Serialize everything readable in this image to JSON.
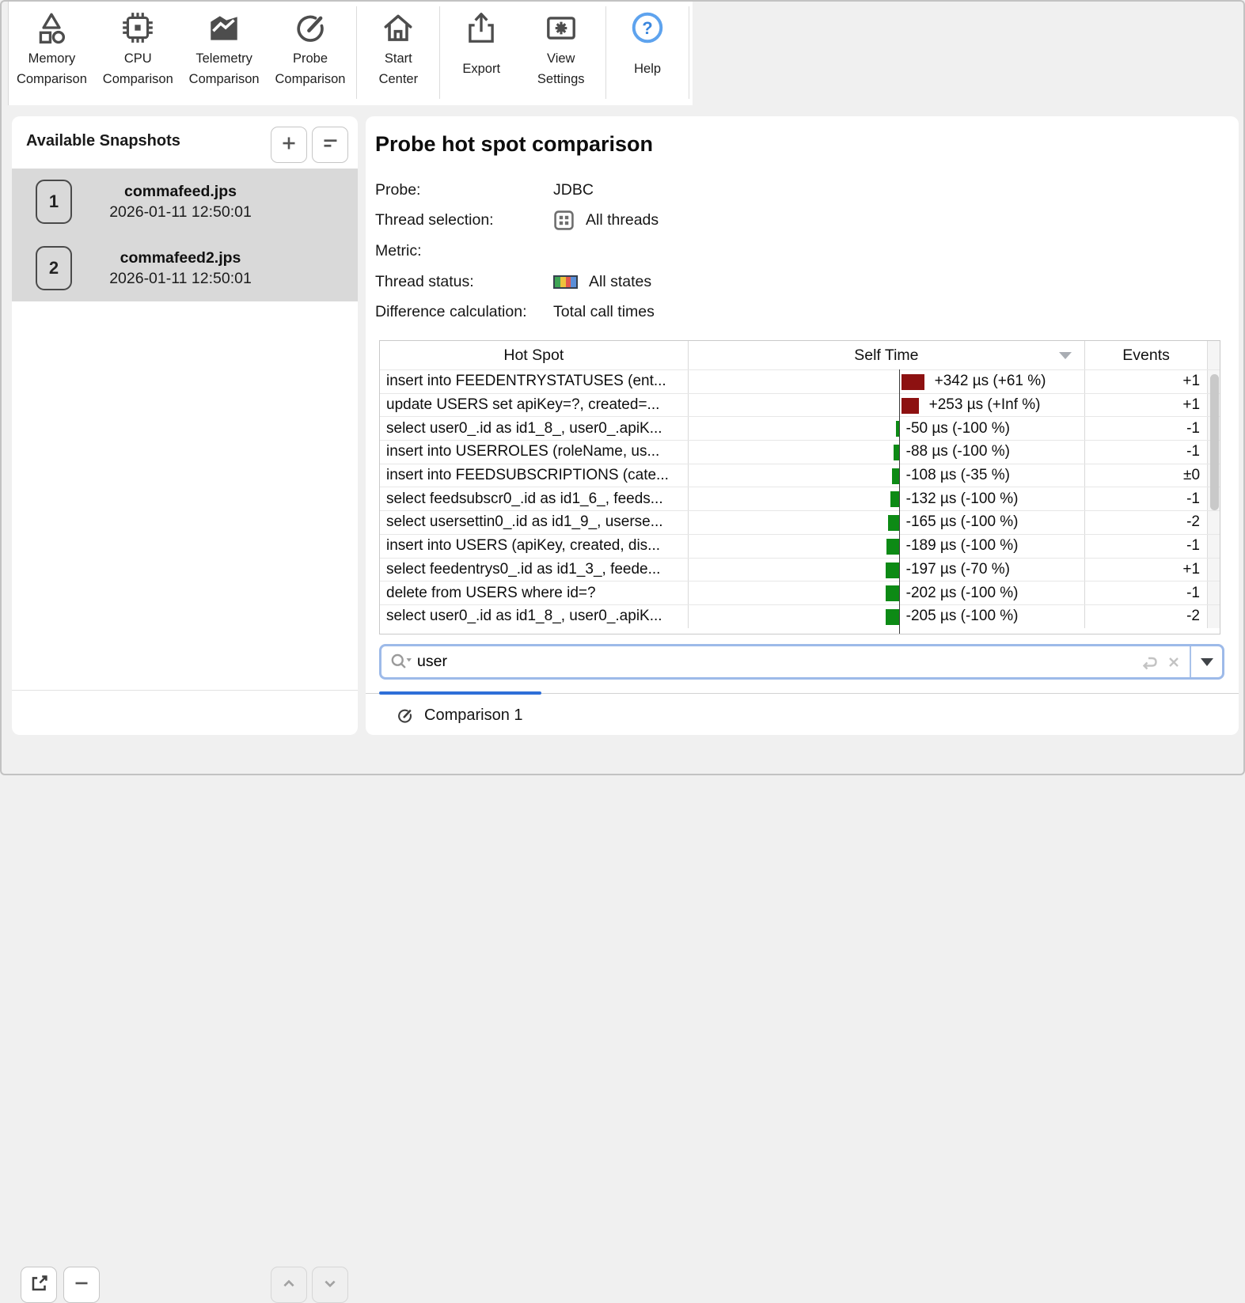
{
  "toolbar": {
    "groups": [
      {
        "items": [
          {
            "id": "memory-comparison",
            "label": "Memory Comparison"
          },
          {
            "id": "cpu-comparison",
            "label": "CPU Comparison"
          },
          {
            "id": "telemetry-comparison",
            "label": "Telemetry Comparison"
          },
          {
            "id": "probe-comparison",
            "label": "Probe Comparison"
          }
        ]
      },
      {
        "items": [
          {
            "id": "start-center",
            "label": "Start Center"
          }
        ]
      },
      {
        "items": [
          {
            "id": "export",
            "label": "Export"
          },
          {
            "id": "view-settings",
            "label": "View Settings"
          }
        ]
      },
      {
        "items": [
          {
            "id": "help",
            "label": "Help"
          }
        ]
      }
    ]
  },
  "snapshots": {
    "title": "Available Snapshots",
    "items": [
      {
        "index": "1",
        "name": "commafeed.jps",
        "date": "2026-01-11 12:50:01",
        "selected": true
      },
      {
        "index": "2",
        "name": "commafeed2.jps",
        "date": "2026-01-11 12:50:01",
        "selected": true
      }
    ]
  },
  "main": {
    "title": "Probe hot spot comparison",
    "details": [
      {
        "label": "Probe:",
        "value": "JDBC",
        "icon": null
      },
      {
        "label": "Thread selection:",
        "value": "All threads",
        "icon": "thread-selection"
      },
      {
        "label": "Metric:",
        "value": "",
        "icon": null
      },
      {
        "label": "Thread status:",
        "value": "All states",
        "icon": "thread-status"
      },
      {
        "label": "Difference calculation:",
        "value": "Total call times",
        "icon": null
      }
    ],
    "search": {
      "value": "user"
    },
    "tab": {
      "label": "Comparison 1"
    }
  },
  "table": {
    "columns": [
      "Hot Spot",
      "Self Time",
      "Events"
    ],
    "sorted_column": "Self Time",
    "rows": [
      {
        "hotspot": "insert into FEEDENTRYSTATUSES (ent...",
        "self_time_us": 342,
        "self_time_label": "+342 µs (+61 %)",
        "events": "+1"
      },
      {
        "hotspot": "update USERS set apiKey=?, created=...",
        "self_time_us": 253,
        "self_time_label": "+253 µs (+Inf %)",
        "events": "+1"
      },
      {
        "hotspot": "select user0_.id as id1_8_, user0_.apiK...",
        "self_time_us": -50,
        "self_time_label": "-50 µs (-100 %)",
        "events": "-1"
      },
      {
        "hotspot": "insert into USERROLES (roleName, us...",
        "self_time_us": -88,
        "self_time_label": "-88 µs (-100 %)",
        "events": "-1"
      },
      {
        "hotspot": "insert into FEEDSUBSCRIPTIONS (cate...",
        "self_time_us": -108,
        "self_time_label": "-108 µs (-35 %)",
        "events": "±0"
      },
      {
        "hotspot": "select feedsubscr0_.id as id1_6_, feeds...",
        "self_time_us": -132,
        "self_time_label": "-132 µs (-100 %)",
        "events": "-1"
      },
      {
        "hotspot": "select usersettin0_.id as id1_9_, userse...",
        "self_time_us": -165,
        "self_time_label": "-165 µs (-100 %)",
        "events": "-2"
      },
      {
        "hotspot": "insert into USERS (apiKey, created, dis...",
        "self_time_us": -189,
        "self_time_label": "-189 µs (-100 %)",
        "events": "-1"
      },
      {
        "hotspot": "select feedentrys0_.id as id1_3_, feede...",
        "self_time_us": -197,
        "self_time_label": "-197 µs (-70 %)",
        "events": "+1"
      },
      {
        "hotspot": "delete from USERS where id=?",
        "self_time_us": -202,
        "self_time_label": "-202 µs (-100 %)",
        "events": "-1"
      },
      {
        "hotspot": "select user0_.id as id1_8_, user0_.apiK...",
        "self_time_us": -205,
        "self_time_label": "-205 µs (-100 %)",
        "events": "-2"
      }
    ]
  },
  "colors": {
    "positive_bar": "#8d1111",
    "negative_bar": "#0d8a15",
    "accent_blue": "#2e6fd8",
    "help_blue": "#5ea3ee",
    "selection_gray": "#d9d9d9",
    "thread_states": [
      "#3fa455",
      "#eec23c",
      "#e2574d",
      "#5b8fd9"
    ]
  }
}
